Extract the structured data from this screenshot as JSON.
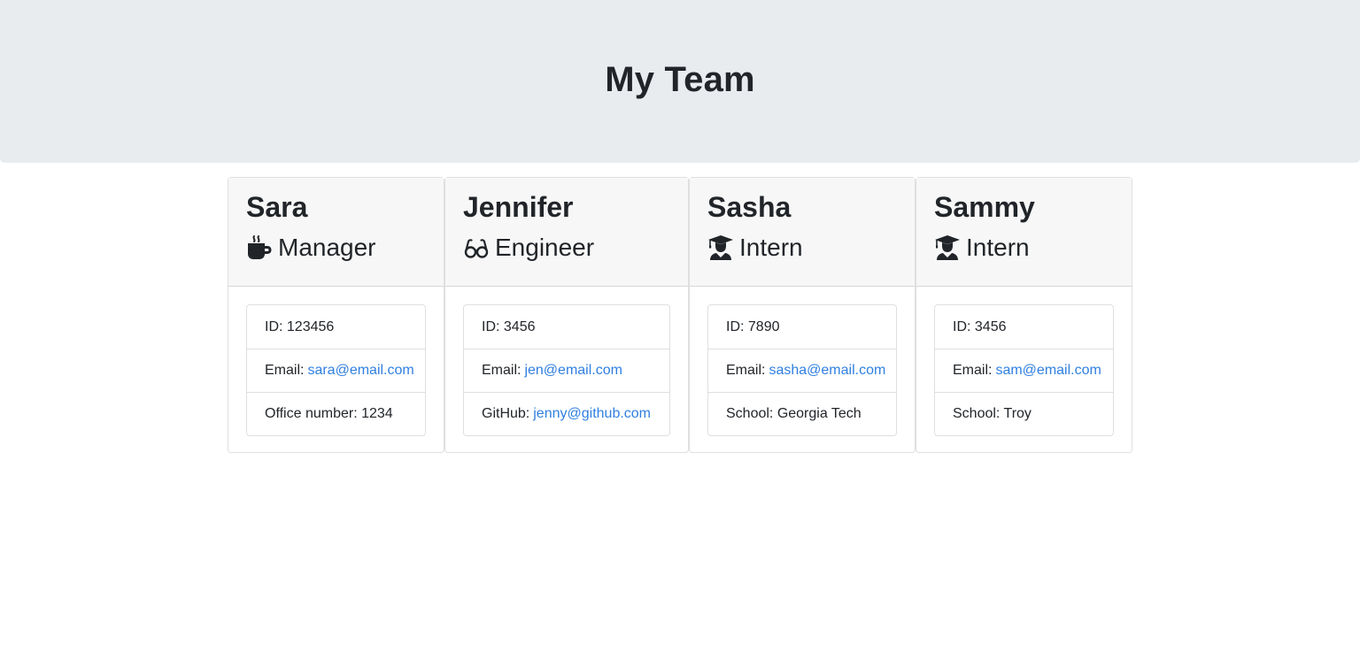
{
  "header": {
    "title": "My Team"
  },
  "team": [
    {
      "name": "Sara",
      "role": "Manager",
      "icon": "coffee-icon",
      "id_label": "ID: 123456",
      "email_label": "Email:",
      "email": "sara@email.com",
      "extra_label": "Office number: 1234",
      "extra_link": ""
    },
    {
      "name": "Jennifer",
      "role": "Engineer",
      "icon": "glasses-icon",
      "id_label": "ID: 3456",
      "email_label": "Email:",
      "email": "jen@email.com",
      "extra_label": "GitHub:",
      "extra_link": "jenny@github.com"
    },
    {
      "name": "Sasha",
      "role": "Intern",
      "icon": "graduate-icon",
      "id_label": "ID: 7890",
      "email_label": "Email:",
      "email": "sasha@email.com",
      "extra_label": "School: Georgia Tech",
      "extra_link": ""
    },
    {
      "name": "Sammy",
      "role": "Intern",
      "icon": "graduate-icon",
      "id_label": "ID: 3456",
      "email_label": "Email:",
      "email": "sam@email.com",
      "extra_label": "School: Troy",
      "extra_link": ""
    }
  ],
  "colors": {
    "header_bg": "#e9ecef",
    "card_header_bg": "#f7f7f7",
    "link": "#2f7fe0",
    "text": "#212529"
  }
}
